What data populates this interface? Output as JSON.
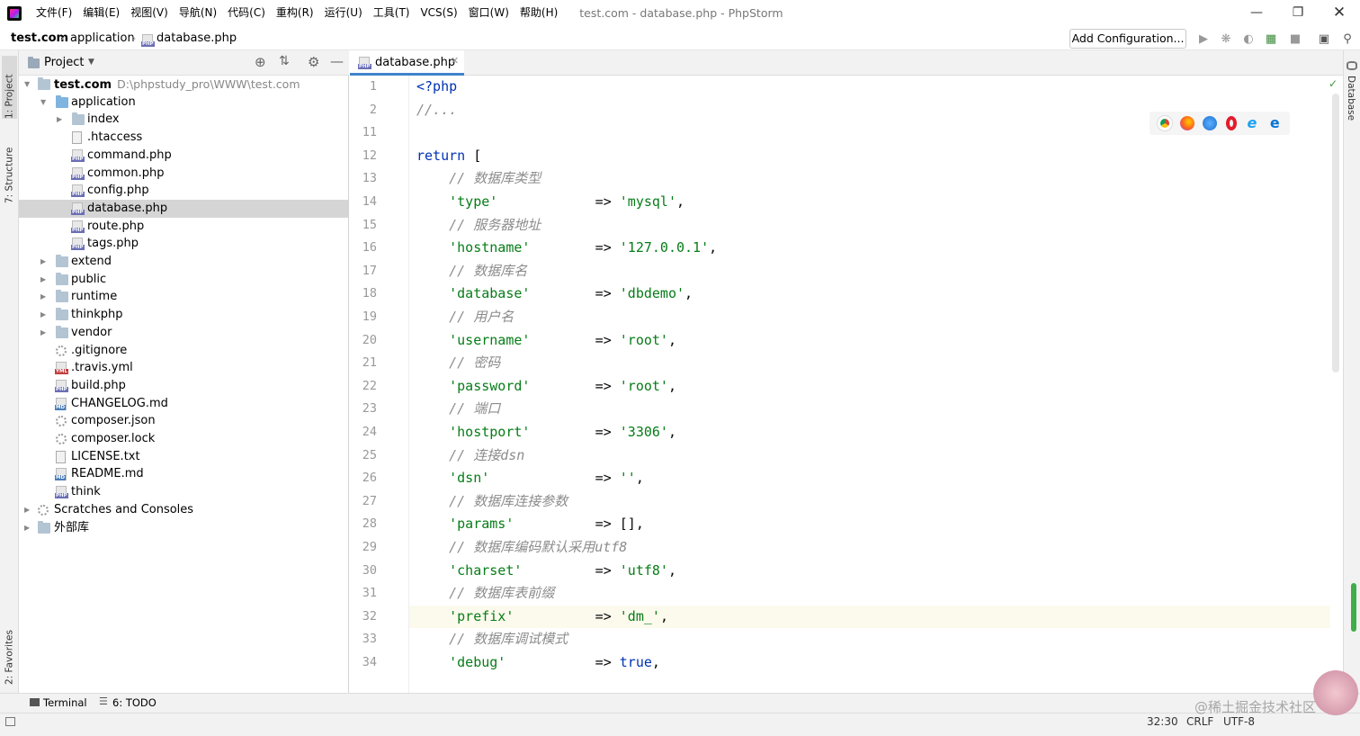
{
  "menu": {
    "items": [
      "文件(F)",
      "编辑(E)",
      "视图(V)",
      "导航(N)",
      "代码(C)",
      "重构(R)",
      "运行(U)",
      "工具(T)",
      "VCS(S)",
      "窗口(W)",
      "帮助(H)"
    ],
    "window_title": "test.com - database.php - PhpStorm"
  },
  "breadcrumb": {
    "root": "test.com",
    "folder": "application",
    "file": "database.php"
  },
  "toolbar": {
    "add_config": "Add Configuration..."
  },
  "side_tabs": {
    "project": "1: Project",
    "structure": "7: Structure",
    "favorites": "2: Favorites",
    "database": "Database"
  },
  "project": {
    "header": "Project",
    "rows": [
      {
        "name": "test.com",
        "path": "D:\\phpstudy_pro\\WWW\\test.com",
        "type": "folder",
        "depth": 0,
        "expanded": true,
        "bold": true
      },
      {
        "name": "application",
        "type": "folder-blue",
        "depth": 1,
        "expanded": true
      },
      {
        "name": "index",
        "type": "folder",
        "depth": 2,
        "expanded": false
      },
      {
        "name": ".htaccess",
        "type": "file",
        "depth": 2
      },
      {
        "name": "command.php",
        "type": "php",
        "depth": 2
      },
      {
        "name": "common.php",
        "type": "php",
        "depth": 2
      },
      {
        "name": "config.php",
        "type": "php",
        "depth": 2
      },
      {
        "name": "database.php",
        "type": "php",
        "depth": 2,
        "selected": true
      },
      {
        "name": "route.php",
        "type": "php",
        "depth": 2
      },
      {
        "name": "tags.php",
        "type": "php",
        "depth": 2
      },
      {
        "name": "extend",
        "type": "folder",
        "depth": 1,
        "expanded": false
      },
      {
        "name": "public",
        "type": "folder",
        "depth": 1,
        "expanded": false
      },
      {
        "name": "runtime",
        "type": "folder",
        "depth": 1,
        "expanded": false
      },
      {
        "name": "thinkphp",
        "type": "folder",
        "depth": 1,
        "expanded": false
      },
      {
        "name": "vendor",
        "type": "folder",
        "depth": 1,
        "expanded": false
      },
      {
        "name": ".gitignore",
        "type": "gear",
        "depth": 1
      },
      {
        "name": ".travis.yml",
        "type": "yml",
        "depth": 1
      },
      {
        "name": "build.php",
        "type": "php",
        "depth": 1
      },
      {
        "name": "CHANGELOG.md",
        "type": "md",
        "depth": 1
      },
      {
        "name": "composer.json",
        "type": "gear",
        "depth": 1
      },
      {
        "name": "composer.lock",
        "type": "gear",
        "depth": 1
      },
      {
        "name": "LICENSE.txt",
        "type": "file",
        "depth": 1
      },
      {
        "name": "README.md",
        "type": "md",
        "depth": 1
      },
      {
        "name": "think",
        "type": "php",
        "depth": 1
      },
      {
        "name": "Scratches and Consoles",
        "type": "scratch",
        "depth": 0,
        "expanded": false
      },
      {
        "name": "外部库",
        "type": "lib",
        "depth": 0,
        "expanded": false
      }
    ]
  },
  "editor": {
    "tab": "database.php",
    "current_line": "32",
    "lines": [
      {
        "n": "1",
        "tokens": [
          {
            "t": "<?php",
            "c": "kw"
          }
        ]
      },
      {
        "n": "2",
        "tokens": [
          {
            "t": "//...",
            "c": "cmt"
          }
        ]
      },
      {
        "n": "11",
        "tokens": []
      },
      {
        "n": "12",
        "tokens": [
          {
            "t": "return ",
            "c": "kw"
          },
          {
            "t": "[",
            "c": "op"
          }
        ]
      },
      {
        "n": "13",
        "tokens": [
          {
            "t": "    // 数据库类型",
            "c": "cmt"
          }
        ]
      },
      {
        "n": "14",
        "tokens": [
          {
            "t": "    'type'",
            "c": "str"
          },
          {
            "t": "            => ",
            "c": "op"
          },
          {
            "t": "'mysql'",
            "c": "str"
          },
          {
            "t": ",",
            "c": "op"
          }
        ]
      },
      {
        "n": "15",
        "tokens": [
          {
            "t": "    // 服务器地址",
            "c": "cmt"
          }
        ]
      },
      {
        "n": "16",
        "tokens": [
          {
            "t": "    'hostname'",
            "c": "str"
          },
          {
            "t": "        => ",
            "c": "op"
          },
          {
            "t": "'127.0.0.1'",
            "c": "str"
          },
          {
            "t": ",",
            "c": "op"
          }
        ]
      },
      {
        "n": "17",
        "tokens": [
          {
            "t": "    // 数据库名",
            "c": "cmt"
          }
        ]
      },
      {
        "n": "18",
        "tokens": [
          {
            "t": "    'database'",
            "c": "str"
          },
          {
            "t": "        => ",
            "c": "op"
          },
          {
            "t": "'dbdemo'",
            "c": "str"
          },
          {
            "t": ",",
            "c": "op"
          }
        ]
      },
      {
        "n": "19",
        "tokens": [
          {
            "t": "    // 用户名",
            "c": "cmt"
          }
        ]
      },
      {
        "n": "20",
        "tokens": [
          {
            "t": "    'username'",
            "c": "str"
          },
          {
            "t": "        => ",
            "c": "op"
          },
          {
            "t": "'root'",
            "c": "str"
          },
          {
            "t": ",",
            "c": "op"
          }
        ]
      },
      {
        "n": "21",
        "tokens": [
          {
            "t": "    // 密码",
            "c": "cmt"
          }
        ]
      },
      {
        "n": "22",
        "tokens": [
          {
            "t": "    'password'",
            "c": "str"
          },
          {
            "t": "        => ",
            "c": "op"
          },
          {
            "t": "'root'",
            "c": "str"
          },
          {
            "t": ",",
            "c": "op"
          }
        ]
      },
      {
        "n": "23",
        "tokens": [
          {
            "t": "    // 端口",
            "c": "cmt"
          }
        ]
      },
      {
        "n": "24",
        "tokens": [
          {
            "t": "    'hostport'",
            "c": "str"
          },
          {
            "t": "        => ",
            "c": "op"
          },
          {
            "t": "'3306'",
            "c": "str"
          },
          {
            "t": ",",
            "c": "op"
          }
        ]
      },
      {
        "n": "25",
        "tokens": [
          {
            "t": "    // 连接dsn",
            "c": "cmt"
          }
        ]
      },
      {
        "n": "26",
        "tokens": [
          {
            "t": "    'dsn'",
            "c": "str"
          },
          {
            "t": "             => ",
            "c": "op"
          },
          {
            "t": "''",
            "c": "str"
          },
          {
            "t": ",",
            "c": "op"
          }
        ]
      },
      {
        "n": "27",
        "tokens": [
          {
            "t": "    // 数据库连接参数",
            "c": "cmt"
          }
        ]
      },
      {
        "n": "28",
        "tokens": [
          {
            "t": "    'params'",
            "c": "str"
          },
          {
            "t": "          => [],",
            "c": "op"
          }
        ]
      },
      {
        "n": "29",
        "tokens": [
          {
            "t": "    // 数据库编码默认采用utf8",
            "c": "cmt"
          }
        ]
      },
      {
        "n": "30",
        "tokens": [
          {
            "t": "    'charset'",
            "c": "str"
          },
          {
            "t": "         => ",
            "c": "op"
          },
          {
            "t": "'utf8'",
            "c": "str"
          },
          {
            "t": ",",
            "c": "op"
          }
        ]
      },
      {
        "n": "31",
        "tokens": [
          {
            "t": "    // 数据库表前缀",
            "c": "cmt"
          }
        ]
      },
      {
        "n": "32",
        "tokens": [
          {
            "t": "    'prefix'",
            "c": "str"
          },
          {
            "t": "          => ",
            "c": "op"
          },
          {
            "t": "'dm_'",
            "c": "str"
          },
          {
            "t": ",",
            "c": "op"
          }
        ]
      },
      {
        "n": "33",
        "tokens": [
          {
            "t": "    // 数据库调试模式",
            "c": "cmt"
          }
        ]
      },
      {
        "n": "34",
        "tokens": [
          {
            "t": "    'debug'",
            "c": "str"
          },
          {
            "t": "           => ",
            "c": "op"
          },
          {
            "t": "true",
            "c": "kw"
          },
          {
            "t": ",",
            "c": "op"
          }
        ]
      }
    ]
  },
  "bottom_tools": {
    "terminal": "Terminal",
    "todo": "6: TODO"
  },
  "status": {
    "position": "32:30",
    "line_sep": "CRLF",
    "encoding": "UTF-8"
  },
  "watermark": "@稀土掘金技术社区",
  "colors": {
    "keyword": "#0033b3",
    "string": "#067d17",
    "comment": "#8c8c8c",
    "selection": "#d5d5d5",
    "tab_accent": "#4083c9"
  }
}
